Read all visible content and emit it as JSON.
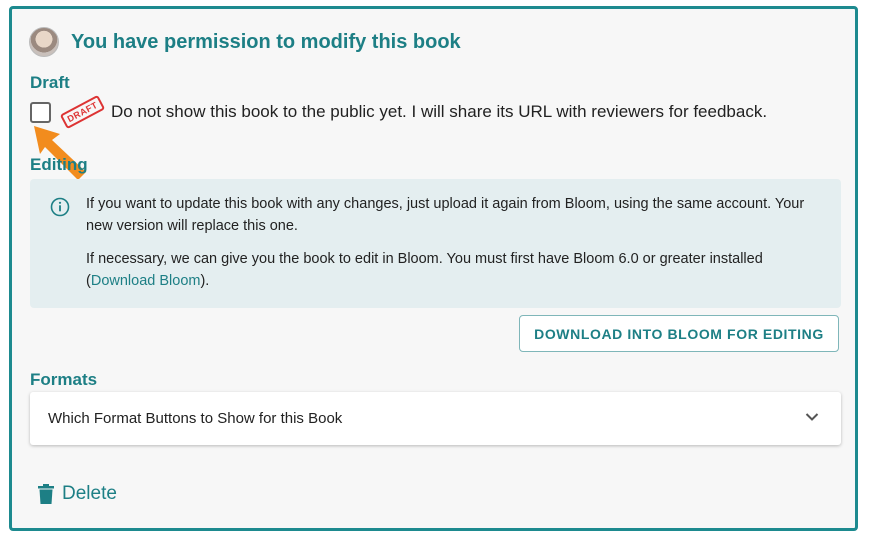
{
  "header": {
    "title": "You have permission to modify this book",
    "avatar_icon": "user-avatar"
  },
  "draft": {
    "section_label": "Draft",
    "stamp_text": "DRAFT",
    "checkbox_checked": false,
    "text": "Do not show this book to the public yet. I will share its URL with reviewers for feedback."
  },
  "editing": {
    "section_label": "Editing",
    "info_line1": "If you want to update this book with any changes, just upload it again from Bloom, using the same account. Your new version will replace this one.",
    "info_line2_prefix": "If necessary, we can give you the book to edit in Bloom. You must first have Bloom 6.0 or greater installed (",
    "info_link": "Download Bloom",
    "info_line2_suffix": ").",
    "download_button": "DOWNLOAD INTO BLOOM FOR EDITING"
  },
  "formats": {
    "section_label": "Formats",
    "accordion_label": "Which Format Buttons to Show for this Book"
  },
  "delete_label": "Delete",
  "colors": {
    "accent": "#1d8a8f",
    "arrow": "#f28c1e",
    "stamp": "#dd3333",
    "info_bg": "#e4eef0"
  }
}
